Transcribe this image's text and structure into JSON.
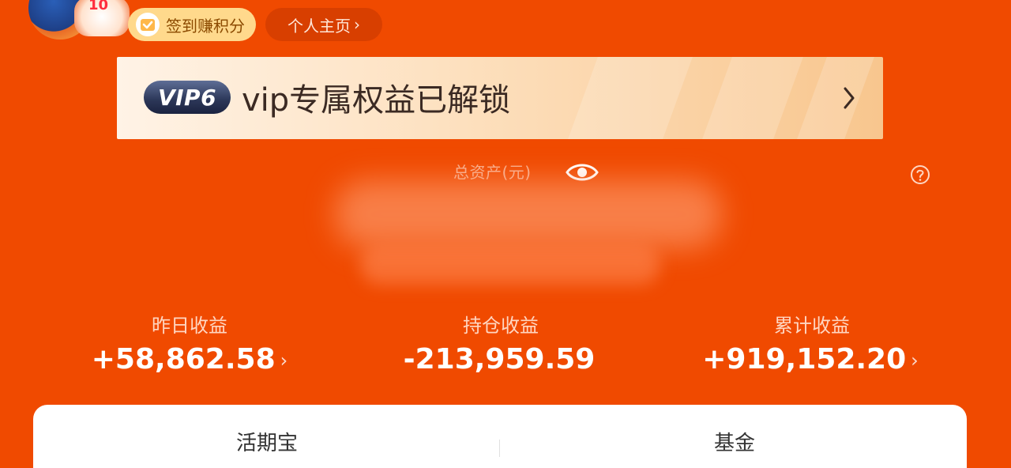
{
  "header": {
    "checkin_label": "签到赚积分",
    "home_label": "个人主页",
    "badge_number": "10"
  },
  "vip": {
    "badge": "VIP6",
    "text": "vip专属权益已解锁"
  },
  "assets": {
    "label": "总资产(元)"
  },
  "stats": [
    {
      "label": "昨日收益",
      "value": "+58,862.58",
      "chevron": true
    },
    {
      "label": "持仓收益",
      "value": "-213,959.59",
      "chevron": false
    },
    {
      "label": "累计收益",
      "value": "+919,152.20",
      "chevron": true
    }
  ],
  "tabs": [
    {
      "label": "活期宝"
    },
    {
      "label": "基金"
    }
  ],
  "colors": {
    "background": "#F04A00",
    "checkin_pill": "#FFD98C",
    "vip_card": "#fde0be"
  }
}
